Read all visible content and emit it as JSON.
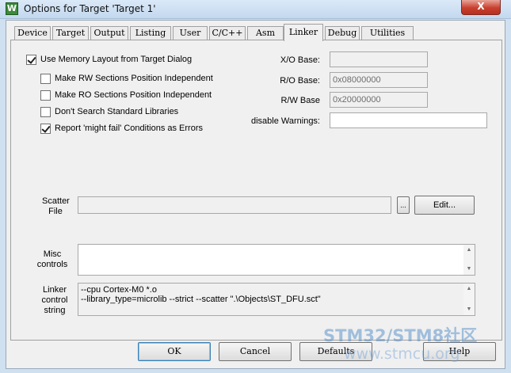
{
  "window": {
    "title": "Options for Target 'Target 1'",
    "icon_glyph": "W",
    "icon_name": "keil-app-icon",
    "close_glyph": "X"
  },
  "tabs": [
    {
      "label": "Device"
    },
    {
      "label": "Target"
    },
    {
      "label": "Output"
    },
    {
      "label": "Listing"
    },
    {
      "label": "User"
    },
    {
      "label": "C/C++"
    },
    {
      "label": "Asm"
    },
    {
      "label": "Linker"
    },
    {
      "label": "Debug"
    },
    {
      "label": "Utilities"
    }
  ],
  "active_tab": "Linker",
  "options": {
    "use_memory_layout": {
      "label": "Use Memory Layout from Target Dialog",
      "checked": true
    },
    "rw_independent": {
      "label": "Make RW Sections Position Independent",
      "checked": false
    },
    "ro_independent": {
      "label": "Make RO Sections Position Independent",
      "checked": false
    },
    "dont_search_libs": {
      "label": "Don't Search Standard Libraries",
      "checked": false
    },
    "might_fail_errors": {
      "label": "Report 'might fail' Conditions as Errors",
      "checked": true
    }
  },
  "fields": {
    "xo_base": {
      "label": "X/O Base:",
      "value": ""
    },
    "ro_base": {
      "label": "R/O Base:",
      "value": "0x08000000"
    },
    "rw_base": {
      "label": "R/W Base",
      "value": "0x20000000"
    },
    "disable_warnings": {
      "label": "disable Warnings:",
      "value": ""
    }
  },
  "scatter": {
    "label_line1": "Scatter",
    "label_line2": "File",
    "value": "",
    "browse_label": "...",
    "edit_label": "Edit..."
  },
  "misc": {
    "label_line1": "Misc",
    "label_line2": "controls",
    "value": ""
  },
  "linker_control": {
    "label_line1": "Linker",
    "label_line2": "control",
    "label_line3": "string",
    "line1": "--cpu Cortex-M0 *.o",
    "line2": "--library_type=microlib --strict --scatter \".\\Objects\\ST_DFU.sct\""
  },
  "buttons": {
    "ok": "OK",
    "cancel": "Cancel",
    "defaults": "Defaults",
    "help": "Help"
  },
  "watermark": {
    "line1": "STM32/STM8社区",
    "line2": "www.stmcu.org"
  },
  "colors": {
    "title_bg": "#cfe0f1",
    "close_button": "#c8402f",
    "dialog_bg": "#f0f0f0"
  }
}
